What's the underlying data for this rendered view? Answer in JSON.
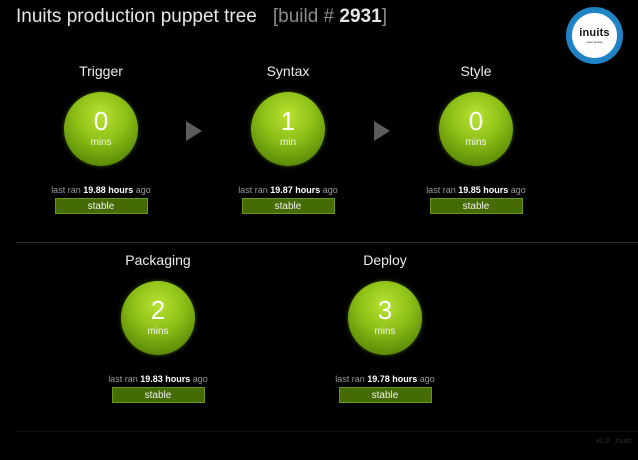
{
  "header": {
    "title": "Inuits production puppet tree",
    "build_prefix": "[build #",
    "build_number": "2931",
    "build_suffix": "]"
  },
  "logo": {
    "name": "inuits",
    "tagline": "open source"
  },
  "colors": {
    "accent": "#8ec117",
    "status_bg": "#456b04",
    "logo_ring": "#1f83c6"
  },
  "stages": [
    {
      "name": "Trigger",
      "value": "0",
      "unit": "mins",
      "last_ran_prefix": "last ran",
      "last_ran": "19.88 hours",
      "last_ran_suffix": "ago",
      "status": "stable"
    },
    {
      "name": "Syntax",
      "value": "1",
      "unit": "min",
      "last_ran_prefix": "last ran",
      "last_ran": "19.87 hours",
      "last_ran_suffix": "ago",
      "status": "stable"
    },
    {
      "name": "Style",
      "value": "0",
      "unit": "mins",
      "last_ran_prefix": "last ran",
      "last_ran": "19.85 hours",
      "last_ran_suffix": "ago",
      "status": "stable"
    },
    {
      "name": "Packaging",
      "value": "2",
      "unit": "mins",
      "last_ran_prefix": "last ran",
      "last_ran": "19.83 hours",
      "last_ran_suffix": "ago",
      "status": "stable"
    },
    {
      "name": "Deploy",
      "value": "3",
      "unit": "mins",
      "last_ran_prefix": "last ran",
      "last_ran": "19.78 hours",
      "last_ran_suffix": "ago",
      "status": "stable"
    }
  ],
  "icons": {
    "arrow": "chevron-right-icon"
  },
  "footer": {
    "credit": "v0.9 · Inuits"
  }
}
